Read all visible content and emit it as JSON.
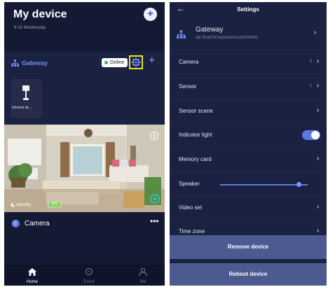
{
  "left": {
    "title": "My device",
    "subtitle": "9-15 Wednesday",
    "add_button": "+",
    "gateway": {
      "label": "Gateway",
      "status": "Online",
      "add": "+"
    },
    "device_card": {
      "label": "Infrared de..."
    },
    "camera_overlay": {
      "standby": "standby",
      "battery": "85%",
      "info": "i"
    },
    "camera_row": {
      "name": "Camera",
      "more": "•••"
    },
    "tabs": [
      {
        "label": "Home",
        "icon": "home-icon",
        "active": true
      },
      {
        "label": "Event",
        "icon": "event-icon",
        "active": false
      },
      {
        "label": "Me",
        "icon": "person-icon",
        "active": false
      }
    ]
  },
  "right": {
    "header": {
      "back": "←",
      "title": "Settings"
    },
    "gateway": {
      "name": "Gateway",
      "did": "did: WJdU7N7epQwShFdzuSK5000000"
    },
    "rows": [
      {
        "label": "Camera",
        "value": "1",
        "type": "chevron"
      },
      {
        "label": "Sensor",
        "value": "1",
        "type": "chevron"
      },
      {
        "label": "Sensor scene",
        "value": "",
        "type": "chevron"
      },
      {
        "label": "Indicator light",
        "value": "",
        "type": "toggle"
      },
      {
        "label": "Memory card",
        "value": "",
        "type": "chevron"
      },
      {
        "label": "Speaker",
        "value": "",
        "type": "slider"
      },
      {
        "label": "Video set",
        "value": "",
        "type": "chevron"
      },
      {
        "label": "Time zone",
        "value": "",
        "type": "chevron"
      }
    ],
    "indicator_light_on": true,
    "speaker_volume_fraction": 0.9,
    "buttons": {
      "remove": "Remove device",
      "reboot": "Reboot device"
    }
  },
  "colors": {
    "background": "#141a33",
    "accent": "#5b79e6",
    "online": "#2bb673",
    "highlight": "#e3e82a"
  }
}
